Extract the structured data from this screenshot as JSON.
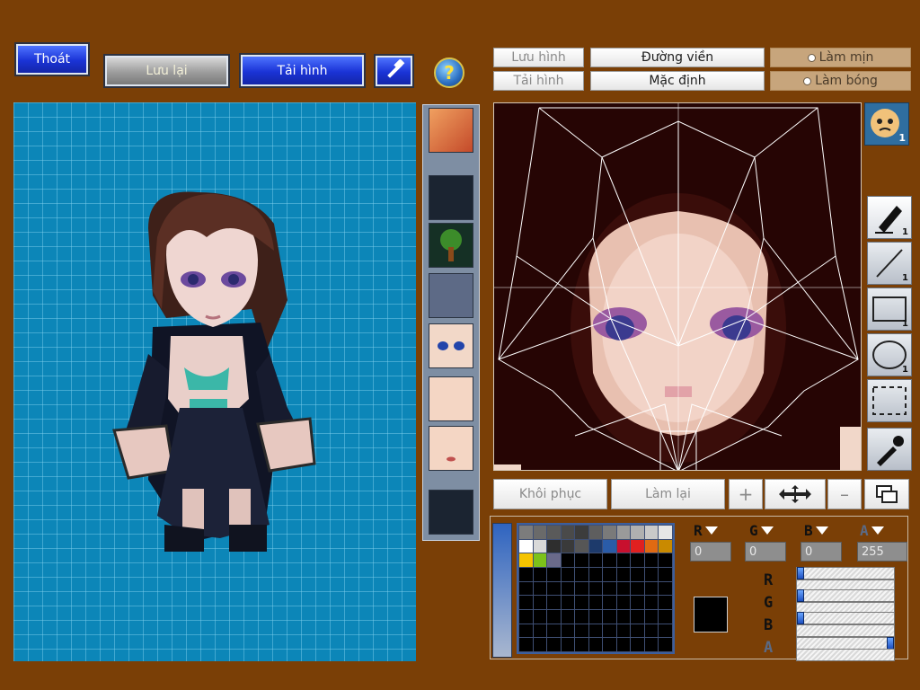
{
  "top_buttons": {
    "exit": "Thoát",
    "save": "Lưu lại",
    "load": "Tải hình",
    "help": "?"
  },
  "face_panel": {
    "save_image": "Lưu hình",
    "load_image": "Tải hình",
    "outline": "Đường viền",
    "default": "Mặc định",
    "smooth": "Làm mịn",
    "shade": "Làm bóng",
    "restore": "Khôi phục",
    "redo": "Làm lại"
  },
  "tools": {
    "face_badge": "1",
    "pen_count": "1",
    "line_count": "1",
    "rect_count": "1",
    "ellipse_count": "1"
  },
  "color": {
    "r_label": "R",
    "g_label": "G",
    "b_label": "B",
    "a_label": "A",
    "r_value": "0",
    "g_value": "0",
    "b_value": "0",
    "a_value": "255",
    "current": "#000000",
    "swatches": [
      "#7c7c7c",
      "#6a6a6a",
      "#5a5a5a",
      "#4a4a4a",
      "#3c3c3c",
      "#5e5e5e",
      "#7a7a7a",
      "#9a9a9a",
      "#b0b0b0",
      "#c9c9c9",
      "#e6e6e6",
      "#ffffff",
      "#d9d9d9",
      "#2e2e2e",
      "#3a3a3a",
      "#565656",
      "#1d3a6b",
      "#2a5ca8",
      "#c8102e",
      "#e02020",
      "#e06a12",
      "#c98a00",
      "#f5c400",
      "#7cc21a",
      "#6a6a8a"
    ],
    "r_level": 0,
    "g_level": 0,
    "b_level": 0,
    "a_level": 1
  }
}
